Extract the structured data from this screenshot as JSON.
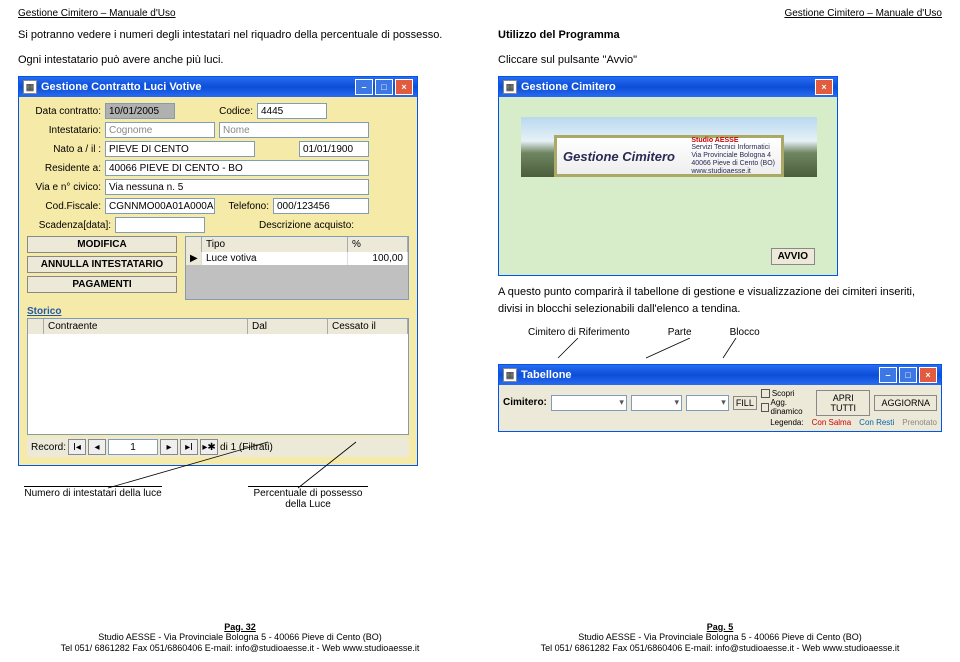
{
  "doc": {
    "title": "Gestione Cimitero – Manuale d'Uso"
  },
  "left": {
    "p1": "Si potranno vedere i numeri degli intestatari nel riquadro della percentuale di possesso.",
    "p2": "Ogni intestatario può avere anche più luci.",
    "annot_num": "Numero di intestatari della luce",
    "annot_perc": "Percentuale di possesso della Luce",
    "footer_page": "Pag. 32",
    "footer_l1": "Studio AESSE - Via Provinciale Bologna 5 - 40066 Pieve di Cento (BO)",
    "footer_l2": "Tel 051/ 6861282 Fax 051/6860406 E-mail: info@studioaesse.it - Web www.studioaesse.it"
  },
  "right": {
    "h1": "Utilizzo del Programma",
    "h2": "Cliccare sul pulsante \"Avvio\"",
    "p1": "A questo punto comparirà il tabellone di gestione e visualizzazione dei cimiteri inseriti, divisi in blocchi selezionabili dall'elenco a tendina.",
    "tag_cim": "Cimitero di Riferimento",
    "tag_parte": "Parte",
    "tag_blocco": "Blocco",
    "footer_page": "Pag. 5",
    "footer_l1": "Studio AESSE - Via Provinciale Bologna 5 - 40066 Pieve di Cento (BO)",
    "footer_l2": "Tel 051/ 6861282 Fax 051/6860406 E-mail: info@studioaesse.it - Web www.studioaesse.it"
  },
  "contract": {
    "title": "Gestione Contratto Luci Votive",
    "lbl_data": "Data contratto:",
    "val_data": "10/01/2005",
    "lbl_codice": "Codice:",
    "val_codice": "4445",
    "lbl_int": "Intestatario:",
    "ph_cognome": "Cognome",
    "ph_nome": "Nome",
    "lbl_nato": "Nato a / il :",
    "val_nato_a": "PIEVE DI CENTO",
    "val_nato_il": "01/01/1900",
    "lbl_res": "Residente a:",
    "val_res": "40066 PIEVE DI CENTO - BO",
    "lbl_via": "Via e n° civico:",
    "val_via": "Via nessuna n. 5",
    "lbl_cf": "Cod.Fiscale:",
    "val_cf": "CGNNMO00A01A000A",
    "lbl_tel": "Telefono:",
    "val_tel": "000/123456",
    "lbl_scad": "Scadenza[data]:",
    "lbl_desc": "Descrizione acquisto:",
    "btn_mod": "MODIFICA",
    "btn_ann": "ANNULLA INTESTATARIO",
    "btn_pag": "PAGAMENTI",
    "grid_tipo": "Tipo",
    "grid_perc": "%",
    "grid_r_tipo": "Luce votiva",
    "grid_r_perc": "100,00",
    "lbl_storico": "Storico",
    "lbl_contraente": "Contraente",
    "lbl_dal": "Dal",
    "lbl_cessato": "Cessato il",
    "rec_label": "Record:",
    "rec_val": "1",
    "rec_of": "di 1 (Filtrati)"
  },
  "launch": {
    "title": "Gestione Cimitero",
    "brand": "Gestione Cimitero",
    "studio": "Studio AESSE",
    "sub1": "Servizi Tecnici Informatici",
    "sub2": "Via Provinciale Bologna 4",
    "sub3": "40066 Pieve di Cento (BO)",
    "sub4": "www.studioaesse.it",
    "avvio": "AVVIO"
  },
  "tabellone": {
    "title": "Tabellone",
    "lbl_cim": "Cimitero:",
    "btn_fill": "FILL",
    "opt1": "Scopri",
    "opt2": "Agg. dinamico",
    "btn_apri": "APRI TUTTI",
    "btn_agg": "AGGIORNA",
    "leg_title": "Legenda:",
    "leg1": "Con Salma",
    "leg2": "Con Resti",
    "leg3": "Prenotato"
  }
}
